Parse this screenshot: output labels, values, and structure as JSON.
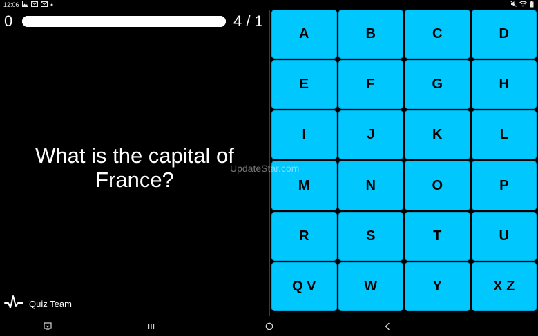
{
  "status_bar": {
    "time": "12:06",
    "left_icons": [
      "image-icon",
      "mail-icon",
      "mail-icon",
      "dot-icon"
    ],
    "right_icons": [
      "mute-icon",
      "wifi-icon",
      "battery-icon"
    ]
  },
  "quiz": {
    "score": "0",
    "progress_fraction": 1.0,
    "counter": "4 / 1",
    "question": "What is the capital of France?"
  },
  "watermark": "UpdateStar.com",
  "footer": {
    "brand_label": "Quiz Team",
    "icon": "pulse-icon"
  },
  "keys": [
    {
      "label": "A"
    },
    {
      "label": "B"
    },
    {
      "label": "C"
    },
    {
      "label": "D"
    },
    {
      "label": "E"
    },
    {
      "label": "F"
    },
    {
      "label": "G"
    },
    {
      "label": "H"
    },
    {
      "label": "I"
    },
    {
      "label": "J"
    },
    {
      "label": "K"
    },
    {
      "label": "L"
    },
    {
      "label": "M"
    },
    {
      "label": "N"
    },
    {
      "label": "O"
    },
    {
      "label": "P"
    },
    {
      "label": "R"
    },
    {
      "label": "S"
    },
    {
      "label": "T"
    },
    {
      "label": "U"
    },
    {
      "label": "Q V"
    },
    {
      "label": "W"
    },
    {
      "label": "Y"
    },
    {
      "label": "X Z"
    }
  ],
  "nav_bar": {
    "icons": [
      "screenshot-icon",
      "recents-icon",
      "home-icon",
      "back-icon"
    ]
  },
  "colors": {
    "key_background": "#00c8ff",
    "background": "#000000",
    "text": "#ffffff"
  }
}
